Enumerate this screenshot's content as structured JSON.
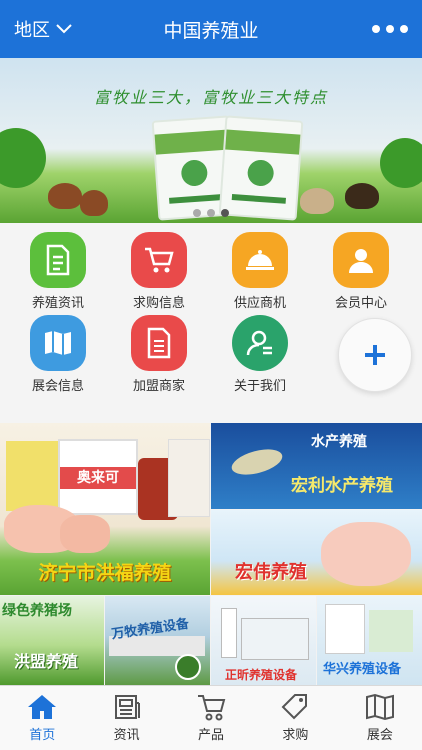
{
  "header": {
    "region_label": "地区",
    "title": "中国养殖业",
    "background": "#1d72d8"
  },
  "banner": {
    "slogan": "富牧业三大，富牧业三大特点",
    "slide_count": 3,
    "active_slide": 2
  },
  "menu": {
    "items": [
      {
        "label": "养殖资讯",
        "icon": "document-icon",
        "color": "#5cbf3c"
      },
      {
        "label": "求购信息",
        "icon": "cart-icon",
        "color": "#e94a4a"
      },
      {
        "label": "供应商机",
        "icon": "service-bell-icon",
        "color": "#f6a623"
      },
      {
        "label": "会员中心",
        "icon": "user-icon",
        "color": "#f6a623"
      },
      {
        "label": "展会信息",
        "icon": "map-icon",
        "color": "#3e9be0"
      },
      {
        "label": "加盟商家",
        "icon": "file-list-icon",
        "color": "#e94a4a"
      },
      {
        "label": "关于我们",
        "icon": "contact-icon",
        "color": "#2aa36b"
      }
    ],
    "plus_icon": "plus-icon"
  },
  "tiles": {
    "t1_caption": "济宁市洪福养殖",
    "t1_brand": "奥来可",
    "t2_caption_top": "水产养殖",
    "t2_caption": "宏利水产养殖",
    "t3_caption": "宏伟养殖",
    "t4_caption_top": "绿色养猪场",
    "t4_caption": "洪盟养殖",
    "t5_caption": "万牧养殖设备",
    "t6_caption": "正昕养殖设备",
    "t7_caption": "华兴养殖设备"
  },
  "tabbar": {
    "tabs": [
      {
        "label": "首页",
        "icon": "home-icon",
        "active": true
      },
      {
        "label": "资讯",
        "icon": "news-icon",
        "active": false
      },
      {
        "label": "产品",
        "icon": "cart-icon",
        "active": false
      },
      {
        "label": "求购",
        "icon": "tag-icon",
        "active": false
      },
      {
        "label": "展会",
        "icon": "map-icon",
        "active": false
      }
    ],
    "active_color": "#1d72d8"
  }
}
